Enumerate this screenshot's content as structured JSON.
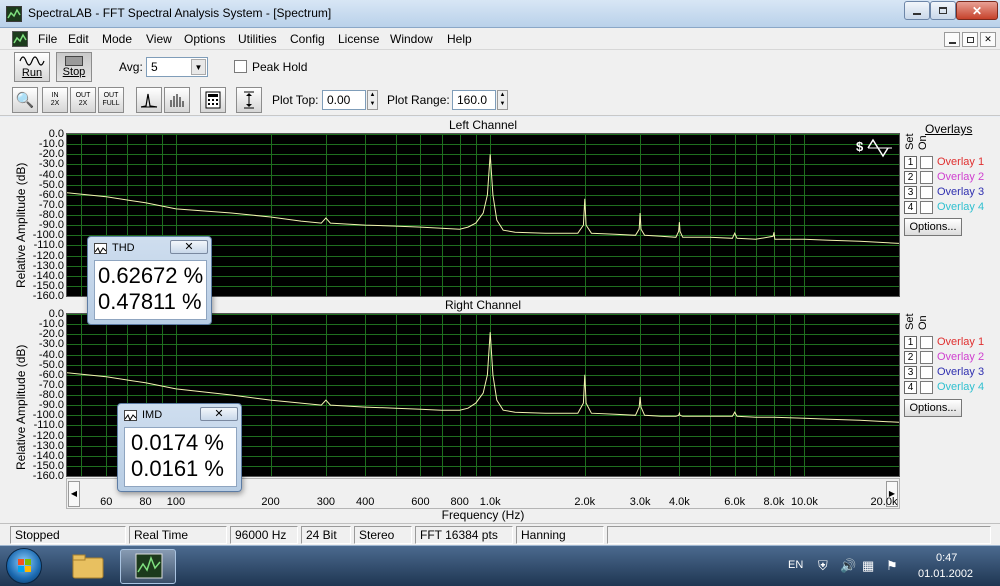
{
  "window": {
    "title": "SpectraLAB - FFT Spectral Analysis System - [Spectrum]"
  },
  "menu": [
    "File",
    "Edit",
    "Mode",
    "View",
    "Options",
    "Utilities",
    "Config",
    "License",
    "Window",
    "Help"
  ],
  "toolbar1": {
    "run_label": "Run",
    "stop_label": "Stop",
    "avg_label": "Avg:",
    "avg_value": "5",
    "peak_hold_label": "Peak Hold"
  },
  "toolbar2": {
    "zoom_in_label": "IN\n2X",
    "zoom_out_label": "OUT\n2X",
    "zoom_full_label": "OUT\nFULL",
    "plot_top_label": "Plot Top:",
    "plot_top_value": "0.00",
    "plot_range_label": "Plot Range:",
    "plot_range_value": "160.0"
  },
  "left_channel": {
    "title": "Left Channel"
  },
  "right_channel": {
    "title": "Right Channel"
  },
  "yaxis": {
    "title": "Relative Amplitude  (dB)",
    "ticks": [
      "0.0",
      "-10.0",
      "-20.0",
      "-30.0",
      "-40.0",
      "-50.0",
      "-60.0",
      "-70.0",
      "-80.0",
      "-90.0",
      "-100.0",
      "-110.0",
      "-120.0",
      "-130.0",
      "-140.0",
      "-150.0",
      "-160.0"
    ]
  },
  "xaxis": {
    "title": "Frequency (Hz)",
    "ticks": [
      {
        "f": 60,
        "label": "60"
      },
      {
        "f": 80,
        "label": "80"
      },
      {
        "f": 100,
        "label": "100"
      },
      {
        "f": 200,
        "label": "200"
      },
      {
        "f": 300,
        "label": "300"
      },
      {
        "f": 400,
        "label": "400"
      },
      {
        "f": 600,
        "label": "600"
      },
      {
        "f": 800,
        "label": "800"
      },
      {
        "f": 1000,
        "label": "1.0k"
      },
      {
        "f": 2000,
        "label": "2.0k"
      },
      {
        "f": 3000,
        "label": "3.0k"
      },
      {
        "f": 4000,
        "label": "4.0k"
      },
      {
        "f": 6000,
        "label": "6.0k"
      },
      {
        "f": 8000,
        "label": "8.0k"
      },
      {
        "f": 10000,
        "label": "10.0k"
      },
      {
        "f": 20000,
        "label": "20.0k"
      }
    ]
  },
  "overlays": {
    "header": "Overlays",
    "set_label": "Set",
    "on_label": "On",
    "options_label": "Options...",
    "items": [
      {
        "num": "1",
        "label": "Overlay 1",
        "color": "#e03030"
      },
      {
        "num": "2",
        "label": "Overlay 2",
        "color": "#d040d0"
      },
      {
        "num": "3",
        "label": "Overlay 3",
        "color": "#3030b0"
      },
      {
        "num": "4",
        "label": "Overlay 4",
        "color": "#30c0d0"
      }
    ]
  },
  "thd_meter": {
    "title": "THD",
    "close": "✕",
    "value_left": "0.62672 %",
    "value_right": "0.47811 %"
  },
  "imd_meter": {
    "title": "IMD",
    "close": "✕",
    "value_left": "0.0174 %",
    "value_right": "0.0161 %"
  },
  "status": [
    "Stopped",
    "Real Time",
    "96000 Hz",
    "24 Bit",
    "Stereo",
    "FFT 16384 pts",
    "Hanning"
  ],
  "tray": {
    "lang": "EN",
    "time": "0:47",
    "date": "01.01.2002"
  },
  "colors": {
    "trace": "#f2f2b0",
    "grid": "#1f6e1f",
    "background": "#000000"
  },
  "chart_data": {
    "type": "line",
    "xscale": "log",
    "xlim": [
      45,
      20000
    ],
    "ylim": [
      -160,
      0
    ],
    "xlabel": "Frequency (Hz)",
    "ylabel": "Relative Amplitude  (dB)",
    "grid": true,
    "charts": [
      {
        "title": "Left Channel",
        "series": [
          {
            "x": [
              45,
              60,
              80,
              100,
              150,
              200,
              250,
              290,
              300,
              310,
              400,
              500,
              600,
              700,
              800,
              850,
              900,
              950,
              980,
              1000,
              1020,
              1050,
              1100,
              1200,
              1500,
              1900,
              1980,
              2000,
              2020,
              2100,
              2500,
              2900,
              2980,
              3000,
              3020,
              3100,
              3500,
              3900,
              3980,
              4000,
              4020,
              4100,
              5000,
              5900,
              6000,
              6100,
              7000,
              7950,
              8000,
              8050,
              10000,
              12000,
              15000,
              20000
            ],
            "y": [
              -58,
              -62,
              -68,
              -74,
              -78,
              -82,
              -86,
              -88,
              -83,
              -88,
              -90,
              -91,
              -92,
              -93,
              -94,
              -92,
              -88,
              -78,
              -60,
              -20,
              -60,
              -85,
              -95,
              -97,
              -98,
              -98,
              -90,
              -64,
              -90,
              -98,
              -99,
              -100,
              -94,
              -78,
              -94,
              -100,
              -101,
              -102,
              -96,
              -87,
              -96,
              -102,
              -102,
              -103,
              -98,
              -103,
              -104,
              -101,
              -97,
              -104,
              -104,
              -105,
              -106,
              -108
            ]
          }
        ]
      },
      {
        "title": "Right Channel",
        "series": [
          {
            "x": [
              45,
              60,
              80,
              100,
              150,
              200,
              250,
              290,
              300,
              310,
              400,
              500,
              600,
              700,
              800,
              850,
              900,
              950,
              980,
              1000,
              1020,
              1050,
              1100,
              1200,
              1500,
              1900,
              1980,
              2000,
              2020,
              2100,
              2500,
              2900,
              2980,
              3000,
              3020,
              3100,
              3500,
              3900,
              3980,
              4000,
              4020,
              4100,
              5000,
              5900,
              6000,
              6100,
              7000,
              8000,
              10000,
              12000,
              15000,
              20000
            ],
            "y": [
              -58,
              -62,
              -68,
              -74,
              -80,
              -85,
              -88,
              -90,
              -85,
              -90,
              -92,
              -93,
              -94,
              -95,
              -95,
              -93,
              -88,
              -78,
              -60,
              -18,
              -60,
              -85,
              -95,
              -97,
              -98,
              -98,
              -88,
              -60,
              -88,
              -98,
              -99,
              -100,
              -92,
              -82,
              -92,
              -100,
              -101,
              -101,
              -100,
              -98,
              -100,
              -101,
              -101,
              -101,
              -97,
              -101,
              -102,
              -102,
              -103,
              -104,
              -105,
              -107
            ]
          }
        ]
      }
    ]
  }
}
